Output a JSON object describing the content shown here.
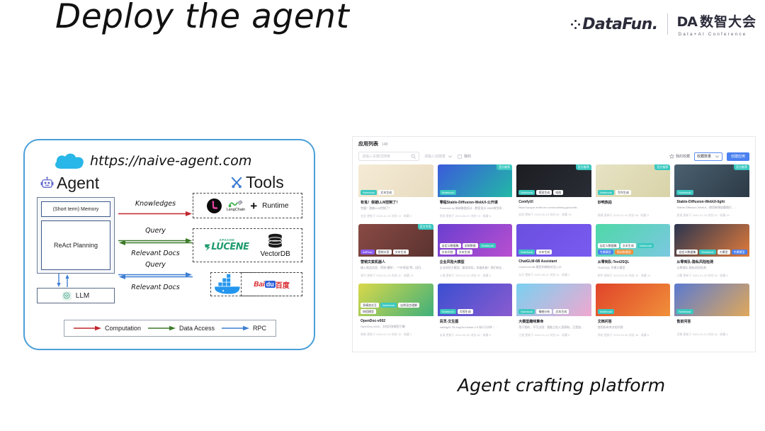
{
  "slide": {
    "title": "Deploy the\nagent",
    "caption": "Agent crafting platform"
  },
  "logo": {
    "datafun_word": "DataFun.",
    "da_mark": "DA",
    "da_cn": "数智大会",
    "da_sub": "Data+AI Conference"
  },
  "diagram": {
    "url": "https://naive-agent.com",
    "agent_heading": "Agent",
    "tools_heading": "Tools",
    "memory_label": "(Short term) Memory",
    "planning_label": "ReAct Planning",
    "llm_label": "LLM",
    "arrows": [
      {
        "label": "Knowledges",
        "color": "#c0272d",
        "dir": "right"
      },
      {
        "label": "Query",
        "color": "#3d7a2a",
        "dir": "right"
      },
      {
        "label": "Relevant Docs",
        "color": "#3d7a2a",
        "dir": "left"
      },
      {
        "label": "Query",
        "color": "#3f7fd4",
        "dir": "right"
      },
      {
        "label": "Relevant Docs",
        "color": "#3f7fd4",
        "dir": "left"
      }
    ],
    "tools": {
      "langchain_label": "LangChain",
      "plus": "+",
      "runtime_label": "Runtime",
      "lucene_apache": "APACHE",
      "lucene_word": "LUCENE",
      "vectordb_label": "VectorDB",
      "baidu_bai": "Bai",
      "baidu_du": "du",
      "baidu_cn": "百度"
    },
    "legend": [
      {
        "label": "Computation",
        "color": "#c0272d"
      },
      {
        "label": "Data Access",
        "color": "#3d7a2a"
      },
      {
        "label": "RPC",
        "color": "#3f7fd4"
      }
    ]
  },
  "app": {
    "title": "应用列表",
    "count": "148",
    "search_placeholder": "请输入关键词搜索",
    "filter_placeholder": "请输入创建者",
    "only_mine_label": "我的",
    "favorites_label": "我的收藏",
    "sort_value": "收藏数量",
    "create_label": "创建应用",
    "cards": [
      {
        "title": "有鬼！我被LLM控制了！",
        "desc": "完蛋！我被LLM控制了！",
        "meta": "金金 更新于 2023-11-15   浏览 10 · 收藏 0",
        "badges": [
          {
            "text": "Notebook",
            "style": "primary"
          },
          {
            "text": "文本生成",
            "style": "light"
          }
        ],
        "corner": "",
        "thumb": "linear-gradient(135deg,#f5ebd6 0%,#e8dcc0 100%)"
      },
      {
        "title": "零程Stable-Diffusion-WebUI-公开课",
        "desc": "Powered by 姊妹聚图设计 - 教室设计 4082帧空间...",
        "meta": "思琪 更新于 2023-08-21   浏览 73 · 收藏 6",
        "badges": [
          {
            "text": "Notebook",
            "style": "primary"
          }
        ],
        "corner": "官方推荐",
        "thumb": "linear-gradient(135deg,#3b5bdb 0%,#22b8a6 100%)"
      },
      {
        "title": "ComfyUI",
        "desc": "https://yuque.antfin.inc.com/nodeeng.gl/ooubfr...",
        "meta": "若男 更新于 2024-06-15   浏览 68 · 收藏 15",
        "badges": [
          {
            "text": "Notebook",
            "style": "primary"
          },
          {
            "text": "视觉生成",
            "style": "light"
          },
          {
            "text": "绘图",
            "style": "light"
          }
        ],
        "corner": "官方推荐",
        "thumb": "linear-gradient(135deg,#1b1d22 0%,#2a2d35 100%)"
      },
      {
        "title": "妙鸭热拍",
        "desc": "",
        "meta": "枫枫 更新于 2023-11-16   浏览 98 · 收藏 9",
        "badges": [
          {
            "text": "Notebook",
            "style": "primary"
          },
          {
            "text": "写作生成",
            "style": "light"
          }
        ],
        "corner": "官方推荐",
        "thumb": "linear-gradient(135deg,#e7e3c4 0%,#d8d3a8 100%)"
      },
      {
        "title": "Stable-Diffusion-WebUI-light",
        "desc": "Stable-Diffusion-WebUI，使用新增加载图片、...",
        "meta": "思琪 更新于 2024-01-23   浏览 53 · 收藏 10",
        "badges": [
          {
            "text": "Notebook",
            "style": "primary"
          }
        ],
        "corner": "官方推荐",
        "thumb": "linear-gradient(135deg,#4a6070 0%,#2d3a46 100%)"
      },
      {
        "title": "营销文案机器人",
        "desc": "输入商品信息、得到“爆款”、“个护家居”等，回归...",
        "meta": "青竹 更新于 2024-01-09   浏览 40 · 收藏 13",
        "badges": [
          {
            "text": "ArtFlow",
            "style": "purple"
          },
          {
            "text": "营销文案",
            "style": "light"
          },
          {
            "text": "文本生成",
            "style": "light"
          }
        ],
        "corner": "官方专用",
        "thumb": "linear-gradient(135deg,#8a4a44 0%,#5a3330 100%)"
      },
      {
        "title": "企业风险大模型",
        "desc": "企业风险大模型，解读风险，知道失能！我们的企...",
        "meta": "公瑾 更新于 2023-12-21   浏览 92 · 收藏 3",
        "badges": [
          {
            "text": "自定义数据集",
            "style": "light"
          },
          {
            "text": "关联数据",
            "style": "light"
          },
          {
            "text": "Notebook",
            "style": "primary"
          },
          {
            "text": "文本问答",
            "style": "light"
          },
          {
            "text": "文本生成",
            "style": "light"
          }
        ],
        "corner": "",
        "thumb": "linear-gradient(135deg,#6a3fd0 0%,#b94fd0 100%)"
      },
      {
        "title": "ChatGLM-6B Assistant",
        "desc": "ChatGLM-6B 模型的辅助对话入口",
        "meta": "允乐 更新于 2023-08-21   浏览 41 · 收藏 2",
        "badges": [
          {
            "text": "Notebook",
            "style": "primary"
          },
          {
            "text": "文本生成",
            "style": "light"
          }
        ],
        "corner": "",
        "thumb": "linear-gradient(135deg,#6a4fe0 0%,#7a5bf0 100%)"
      },
      {
        "title": "从零到队-Text2SQL",
        "desc": "Text2SQL 专属大模型",
        "meta": "鹤宇 更新于 2024-02-05   浏览 32 · 收藏 10",
        "badges": [
          {
            "text": "自定义数据集",
            "style": "light"
          },
          {
            "text": "文本生成",
            "style": "light"
          },
          {
            "text": "Notebook",
            "style": "primary"
          },
          {
            "text": "专属模型",
            "style": "blue"
          },
          {
            "text": "预训练模型",
            "style": "orange"
          }
        ],
        "corner": "",
        "thumb": "linear-gradient(135deg,#4fd8a8 0%,#7ac8e0 100%)"
      },
      {
        "title": "从零到队-隐私风险检测",
        "desc": "认零到队-隐私风险检测",
        "meta": "川麓 更新于 2024-01-25   浏览 30 · 收藏 4",
        "badges": [
          {
            "text": "自定义数据集",
            "style": "light"
          },
          {
            "text": "Notebook",
            "style": "primary"
          },
          {
            "text": "大模型",
            "style": "light"
          },
          {
            "text": "专属模型",
            "style": "blue"
          }
        ],
        "corner": "",
        "thumb": "linear-gradient(135deg,#2b3550 0%,#e07a3a 100%)"
      },
      {
        "title": "OpenDoc-v002",
        "desc": "OpenDoc-v002，文档问答模型引擎",
        "meta": "晓勇 更新于 2024-01-04   浏览 35 · 收藏 1",
        "badges": [
          {
            "text": "多模态交互",
            "style": "light"
          },
          {
            "text": "Notebook",
            "style": "primary"
          },
          {
            "text": "自然语言理解",
            "style": "light"
          },
          {
            "text": "快搭模型",
            "style": "light"
          }
        ],
        "corner": "",
        "thumb": "linear-gradient(135deg,#d9d84a 0%,#3fb07a 100%)"
      },
      {
        "title": "百灵-文生图",
        "desc": "bailingAI-7B-ImgGen-Base-2.5 如2万分钟｜...",
        "meta": "玄清 更新于 2024-06-20   浏览 82 · 收藏 9",
        "badges": [
          {
            "text": "Notebook",
            "style": "primary"
          },
          {
            "text": "可视生成",
            "style": "light"
          }
        ],
        "corner": "",
        "thumb": "linear-gradient(135deg,#3b4fd0 0%,#8a5bd0 100%)"
      },
      {
        "title": "大模型趣味算命",
        "desc": "用于我的，不可当用：我能之粒入里获取，正是加...",
        "meta": "江楼 更新于 2024-01-12   浏览 33 · 收藏 5",
        "badges": [
          {
            "text": "Notebook",
            "style": "primary"
          },
          {
            "text": "情感分析",
            "style": "light"
          },
          {
            "text": "文本生成",
            "style": "light"
          }
        ],
        "corner": "",
        "thumb": "linear-gradient(135deg,#7ad0f0 0%,#f0a8d0 100%)"
      },
      {
        "title": "文档问答",
        "desc": "使用私有库文档问答",
        "meta": "季柏 更新于 2023-10-28   浏览 36 · 收藏 6",
        "badges": [
          {
            "text": "Notebook",
            "style": "primary"
          }
        ],
        "corner": "",
        "thumb": "linear-gradient(135deg,#e0442a 0%,#f0903a 100%)"
      },
      {
        "title": "售前问答",
        "desc": "",
        "meta": "凌霄 更新于 2023-03-21   浏览 36 · 收藏 4",
        "badges": [
          {
            "text": "Notebook",
            "style": "primary"
          }
        ],
        "corner": "",
        "thumb": "linear-gradient(135deg,#5b7ad0 0%,#e0a85a 100%)"
      }
    ]
  }
}
